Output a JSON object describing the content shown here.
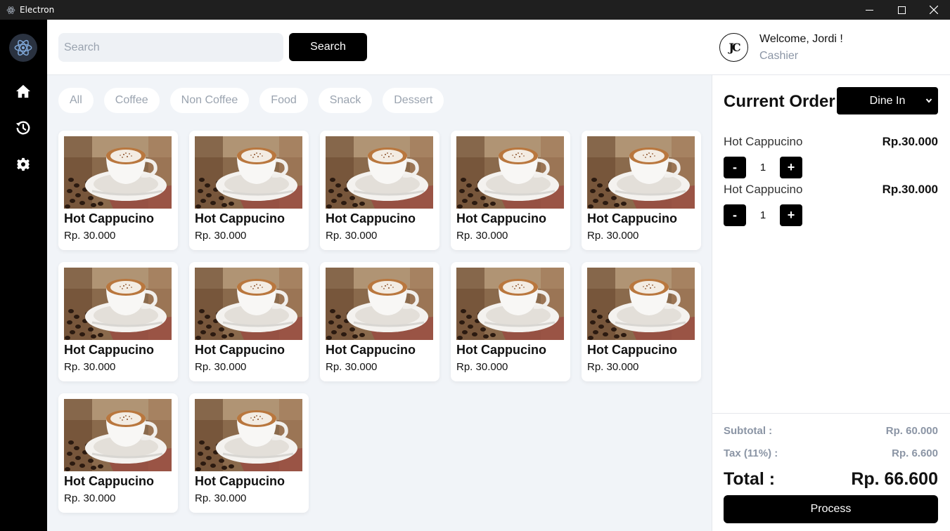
{
  "window": {
    "title": "Electron"
  },
  "sidebar": {
    "logo_icon": "electron-atom-icon",
    "items": [
      {
        "id": "home",
        "icon": "home-icon"
      },
      {
        "id": "history",
        "icon": "history-icon"
      },
      {
        "id": "settings",
        "icon": "gear-icon"
      }
    ]
  },
  "search": {
    "placeholder": "Search",
    "value": "",
    "button_label": "Search"
  },
  "user": {
    "avatar_initials": "JC",
    "greeting": "Welcome, Jordi !",
    "role": "Cashier"
  },
  "categories": [
    "All",
    "Coffee",
    "Non Coffee",
    "Food",
    "Snack",
    "Dessert"
  ],
  "products": [
    {
      "name": "Hot Cappucino",
      "price": "Rp. 30.000"
    },
    {
      "name": "Hot Cappucino",
      "price": "Rp. 30.000"
    },
    {
      "name": "Hot Cappucino",
      "price": "Rp. 30.000"
    },
    {
      "name": "Hot Cappucino",
      "price": "Rp. 30.000"
    },
    {
      "name": "Hot Cappucino",
      "price": "Rp. 30.000"
    },
    {
      "name": "Hot Cappucino",
      "price": "Rp. 30.000"
    },
    {
      "name": "Hot Cappucino",
      "price": "Rp. 30.000"
    },
    {
      "name": "Hot Cappucino",
      "price": "Rp. 30.000"
    },
    {
      "name": "Hot Cappucino",
      "price": "Rp. 30.000"
    },
    {
      "name": "Hot Cappucino",
      "price": "Rp. 30.000"
    },
    {
      "name": "Hot Cappucino",
      "price": "Rp. 30.000"
    },
    {
      "name": "Hot Cappucino",
      "price": "Rp. 30.000"
    }
  ],
  "order": {
    "title": "Current Order",
    "type_selected": "Dine In",
    "items": [
      {
        "name": "Hot Cappucino",
        "price": "Rp.30.000",
        "qty": "1",
        "minus": "-",
        "plus": "+"
      },
      {
        "name": "Hot Cappucino",
        "price": "Rp.30.000",
        "qty": "1",
        "minus": "-",
        "plus": "+"
      }
    ],
    "subtotal_label": "Subtotal :",
    "subtotal_value": "Rp. 60.000",
    "tax_label": "Tax (11%) :",
    "tax_value": "Rp. 6.600",
    "total_label": "Total :",
    "total_value": "Rp. 66.600",
    "process_label": "Process"
  },
  "colors": {
    "accent": "#000000",
    "muted": "#8b95a5",
    "background": "#f1f4f8"
  }
}
